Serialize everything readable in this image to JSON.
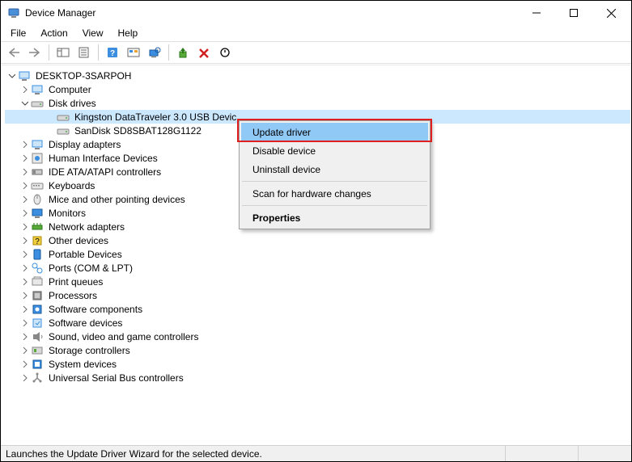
{
  "window": {
    "title": "Device Manager"
  },
  "menu": {
    "file": "File",
    "action": "Action",
    "view": "View",
    "help": "Help"
  },
  "tree": {
    "root": "DESKTOP-3SARPOH",
    "computer": "Computer",
    "disk_drives": "Disk drives",
    "disk_children": [
      "Kingston DataTraveler 3.0 USB Devic",
      "SanDisk SD8SBAT128G1122"
    ],
    "categories": [
      "Display adapters",
      "Human Interface Devices",
      "IDE ATA/ATAPI controllers",
      "Keyboards",
      "Mice and other pointing devices",
      "Monitors",
      "Network adapters",
      "Other devices",
      "Portable Devices",
      "Ports (COM & LPT)",
      "Print queues",
      "Processors",
      "Software components",
      "Software devices",
      "Sound, video and game controllers",
      "Storage controllers",
      "System devices",
      "Universal Serial Bus controllers"
    ]
  },
  "context_menu": {
    "update": "Update driver",
    "disable": "Disable device",
    "uninstall": "Uninstall device",
    "scan": "Scan for hardware changes",
    "properties": "Properties"
  },
  "statusbar": {
    "text": "Launches the Update Driver Wizard for the selected device."
  }
}
